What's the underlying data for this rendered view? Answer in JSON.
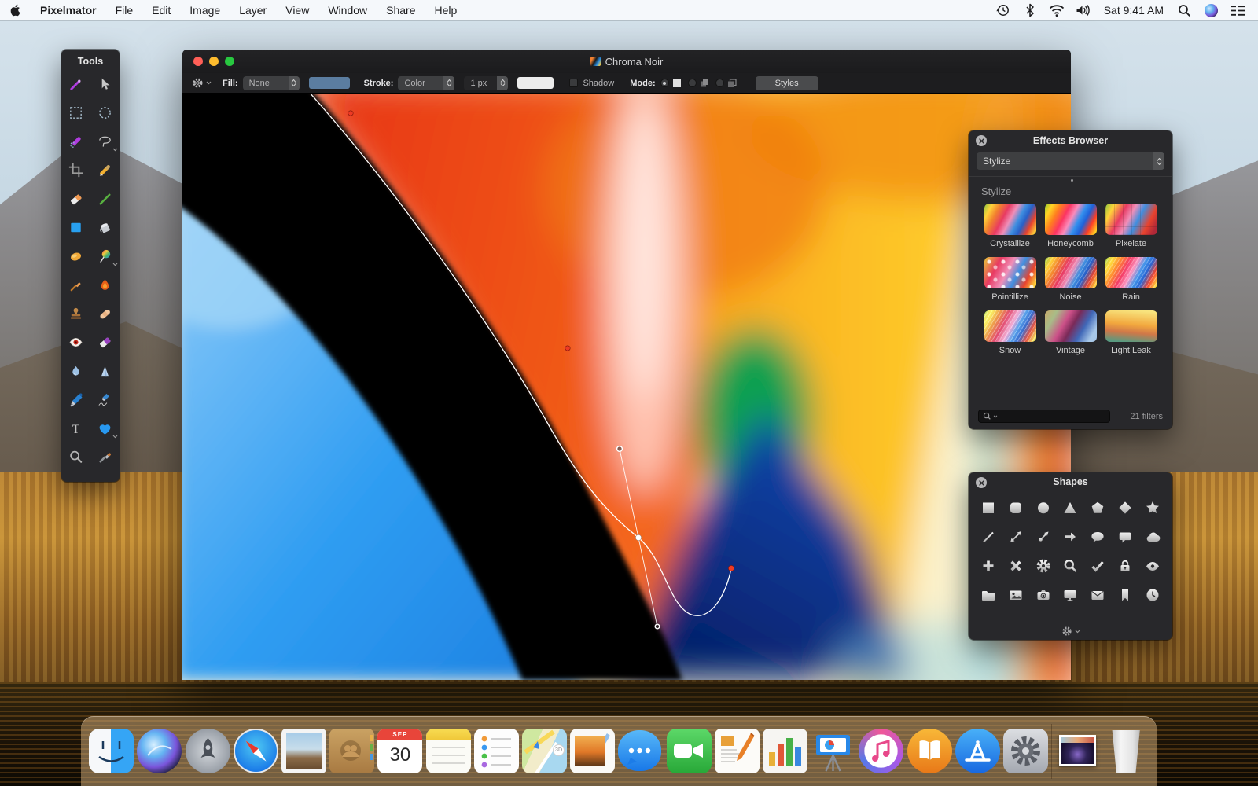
{
  "menu_bar": {
    "app_name": "Pixelmator",
    "menus": [
      "File",
      "Edit",
      "Image",
      "Layer",
      "View",
      "Window",
      "Share",
      "Help"
    ],
    "status_clock": "Sat 9:41 AM",
    "status_icons": [
      "time-machine-icon",
      "bluetooth-icon",
      "wifi-icon",
      "volume-icon",
      "spotlight-icon",
      "siri-icon",
      "notification-center-icon"
    ]
  },
  "tools_panel": {
    "title": "Tools",
    "tools": [
      "move-tool",
      "arrow-tool",
      "rect-select-tool",
      "ellipse-select-tool",
      "paint-select-tool",
      "lasso-tool",
      "crop-tool",
      "pencil-tool",
      "eraser-tool",
      "line-tool",
      "shape-tool",
      "paint-bucket-tool",
      "dodge-tool",
      "gradient-tool",
      "smudge-tool",
      "burn-tool",
      "clone-stamp-tool",
      "healing-tool",
      "red-eye-tool",
      "erase-object-tool",
      "blur-tool",
      "sharpen-tool",
      "pen-tool",
      "freeform-pen-tool",
      "type-tool",
      "custom-shape-tool",
      "zoom-tool",
      "eyedropper-tool"
    ]
  },
  "document_window": {
    "title": "Chroma Noir",
    "toolbar": {
      "fill_label": "Fill:",
      "fill_value": "None",
      "fill_swatch_color": "#5b7da0",
      "stroke_label": "Stroke:",
      "stroke_value": "Color",
      "stroke_width_value": "1 px",
      "stroke_swatch_color": "#ececec",
      "shadow_label": "Shadow",
      "mode_label": "Mode:",
      "mode_options": [
        "solid",
        "union",
        "subtract"
      ],
      "styles_button": "Styles"
    }
  },
  "effects_browser": {
    "title": "Effects Browser",
    "category_value": "Stylize",
    "section_title": "Stylize",
    "filters": [
      "Crystallize",
      "Honeycomb",
      "Pixelate",
      "Pointillize",
      "Noise",
      "Rain",
      "Snow",
      "Vintage",
      "Light Leak"
    ],
    "filter_count": "21 filters"
  },
  "shapes_panel": {
    "title": "Shapes",
    "shapes": [
      "square",
      "rounded-square",
      "circle",
      "triangle",
      "pentagon",
      "diamond",
      "star",
      "line",
      "double-arrow",
      "arrow-endpoint",
      "arrow-right",
      "speech-bubble-round",
      "speech-bubble-square",
      "cloud",
      "plus",
      "x-mark",
      "gear",
      "magnifier",
      "checkmark",
      "lock",
      "eye",
      "folder",
      "picture",
      "camera",
      "monitor",
      "envelope",
      "bookmark",
      "clock"
    ]
  },
  "dock": {
    "items": [
      "finder",
      "siri",
      "launchpad",
      "safari",
      "mail",
      "contacts",
      "calendar",
      "notes",
      "reminders",
      "maps",
      "photos",
      "messages",
      "facetime",
      "pages",
      "numbers",
      "keynote",
      "itunes",
      "ibooks",
      "app-store",
      "system-preferences",
      "minimized-window",
      "trash"
    ],
    "calendar_month": "SEP",
    "calendar_day": "30",
    "maps_badge": "3D"
  }
}
